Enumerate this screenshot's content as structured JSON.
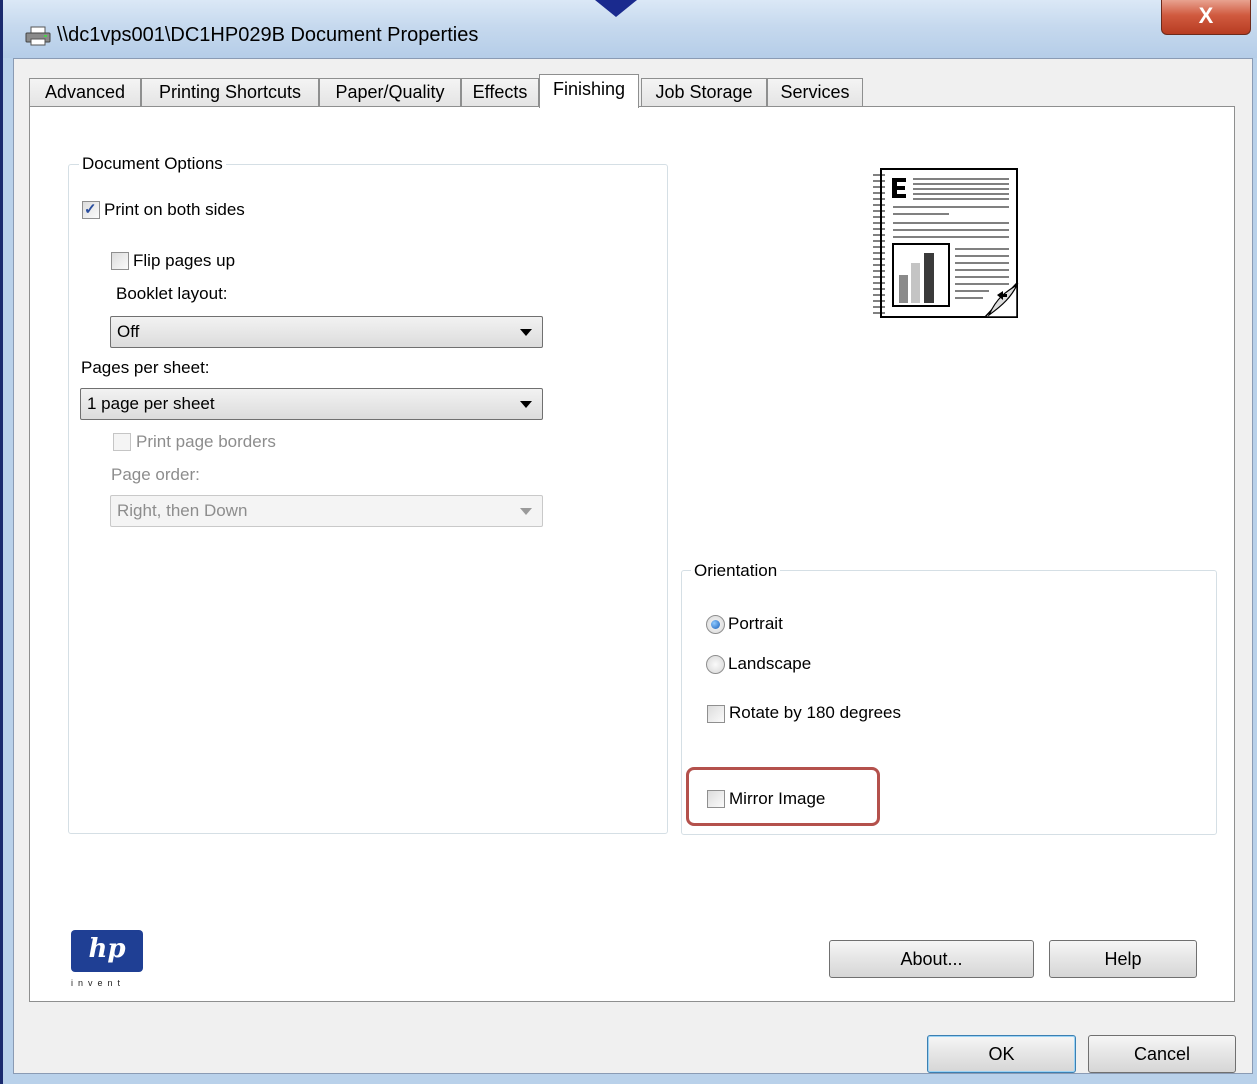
{
  "window": {
    "title": "\\\\dc1vps001\\DC1HP029B Document Properties",
    "close_label": "X"
  },
  "tabs": [
    {
      "label": "Advanced"
    },
    {
      "label": "Printing Shortcuts"
    },
    {
      "label": "Paper/Quality"
    },
    {
      "label": "Effects"
    },
    {
      "label": "Finishing",
      "active": true
    },
    {
      "label": "Job Storage"
    },
    {
      "label": "Services"
    }
  ],
  "document_options": {
    "group_label": "Document Options",
    "print_both_sides": {
      "label": "Print on both sides",
      "checked": true
    },
    "flip_pages_up": {
      "label": "Flip pages up",
      "checked": false
    },
    "booklet_layout": {
      "label": "Booklet layout:",
      "value": "Off"
    },
    "pages_per_sheet": {
      "label": "Pages per sheet:",
      "value": "1 page per sheet"
    },
    "print_page_borders": {
      "label": "Print page borders",
      "checked": false,
      "disabled": true
    },
    "page_order": {
      "label": "Page order:",
      "value": "Right, then Down",
      "disabled": true
    }
  },
  "orientation": {
    "group_label": "Orientation",
    "portrait": {
      "label": "Portrait",
      "selected": true
    },
    "landscape": {
      "label": "Landscape",
      "selected": false
    },
    "rotate_180": {
      "label": "Rotate by 180 degrees",
      "checked": false
    },
    "mirror_image": {
      "label": "Mirror Image",
      "checked": false
    }
  },
  "buttons": {
    "about": "About...",
    "help": "Help",
    "ok": "OK",
    "cancel": "Cancel"
  },
  "logo": {
    "text": "hp",
    "tagline": "invent"
  },
  "colors": {
    "highlight": "#b4514c",
    "hp_blue": "#1f3f94",
    "title_bar": "#c6d9ee",
    "close_button": "#c7462b"
  }
}
